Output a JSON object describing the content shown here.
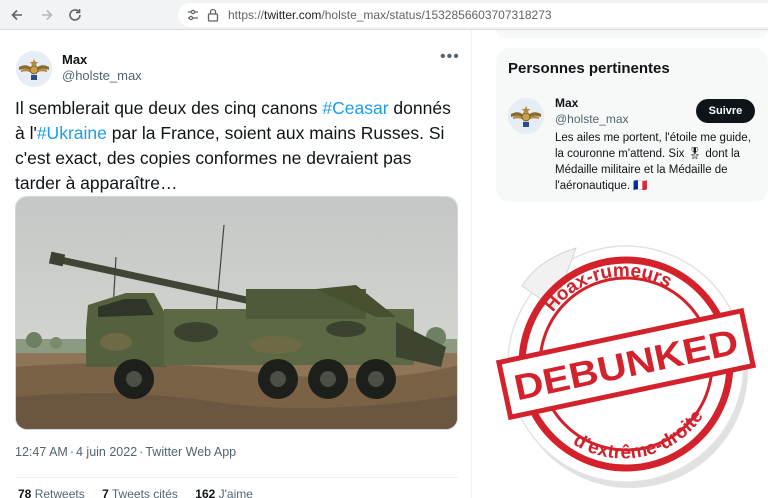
{
  "browser": {
    "url_prefix": "https://",
    "url_domain": "twitter.com",
    "url_path": "/holste_max/status/1532856603707318273",
    "back_icon": "arrow-left-icon",
    "forward_icon": "arrow-right-icon",
    "reload_icon": "reload-icon"
  },
  "tweet": {
    "author_name": "Max",
    "author_handle": "@holste_max",
    "text_part1": "Il semblerait que deux des cinq canons ",
    "hashtag1": "#Ceasar",
    "text_part2": " donnés à l'",
    "hashtag2": "#Ukraine",
    "text_part3": " par la France, soient aux mains Russes. Si c'est exact, des copies conformes ne devraient pas tarder à apparaître…",
    "time": "12:47 AM",
    "date": "4 juin 2022",
    "source": "Twitter Web App",
    "retweets_count": "78",
    "retweets_label": "Retweets",
    "quotes_count": "7",
    "quotes_label": "Tweets cités",
    "likes_count": "162",
    "likes_label": "J'aime"
  },
  "sidebar": {
    "title": "Personnes pertinentes",
    "name": "Max",
    "handle": "@holste_max",
    "follow_label": "Suivre",
    "bio_part1": "Les ailes me portent, l'étoile me guide, la couronne m'attend. Six ",
    "bio_part2": " dont la Médaille militaire et la Médaille de l'aéronautique. ",
    "medal_emoji": "🎖",
    "flag_emoji": "🇫🇷"
  },
  "sticker": {
    "top_text": "Hoax-rumeurs",
    "main_text": "DEBUNKED",
    "bottom_text": "d'extrême-droite",
    "color": "#d3222c"
  }
}
